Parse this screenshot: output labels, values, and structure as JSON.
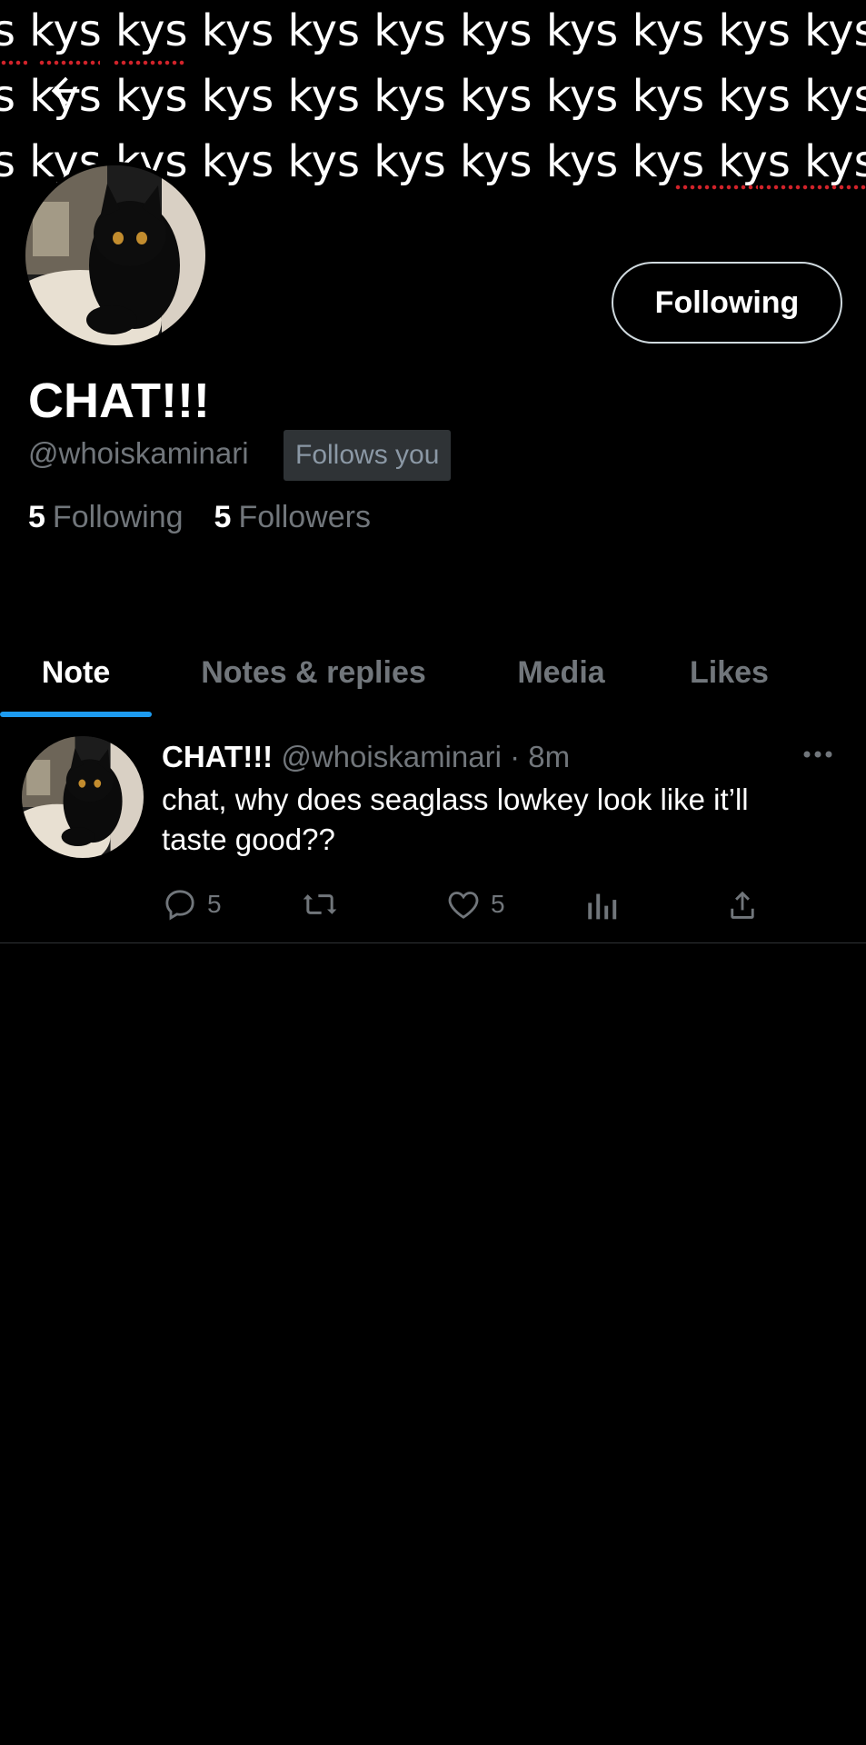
{
  "banner": {
    "lines": [
      "s kys kys kys kys kys kys kys kys kys kys ky",
      "s kys kys kys kys kys kys kys kys kys kys ky",
      "s kys kys kys kys kys kys kys kys kys kys ky"
    ]
  },
  "profile": {
    "display_name": "CHAT!!!",
    "handle": "@whoiskaminari",
    "follows_you": "Follows you",
    "follow_button": "Following",
    "following_count": "5",
    "following_label": "Following",
    "followers_count": "5",
    "followers_label": "Followers"
  },
  "tabs": [
    {
      "label": "Note",
      "active": true
    },
    {
      "label": "Notes & replies",
      "active": false
    },
    {
      "label": "Media",
      "active": false
    },
    {
      "label": "Likes",
      "active": false
    }
  ],
  "post": {
    "name": "CHAT!!!",
    "meta": "@whoiskaminari · 8m",
    "text": "chat, why does seaglass lowkey look like it’ll taste good??",
    "reply_count": "5",
    "like_count": "5"
  },
  "colors": {
    "background": "#000000",
    "accent": "#1d9bf0",
    "muted": "#71767b",
    "badge_bg": "#2f3336"
  },
  "icons": [
    "back-arrow-icon",
    "more-icon",
    "reply-icon",
    "repost-icon",
    "like-icon",
    "views-icon",
    "share-icon"
  ]
}
